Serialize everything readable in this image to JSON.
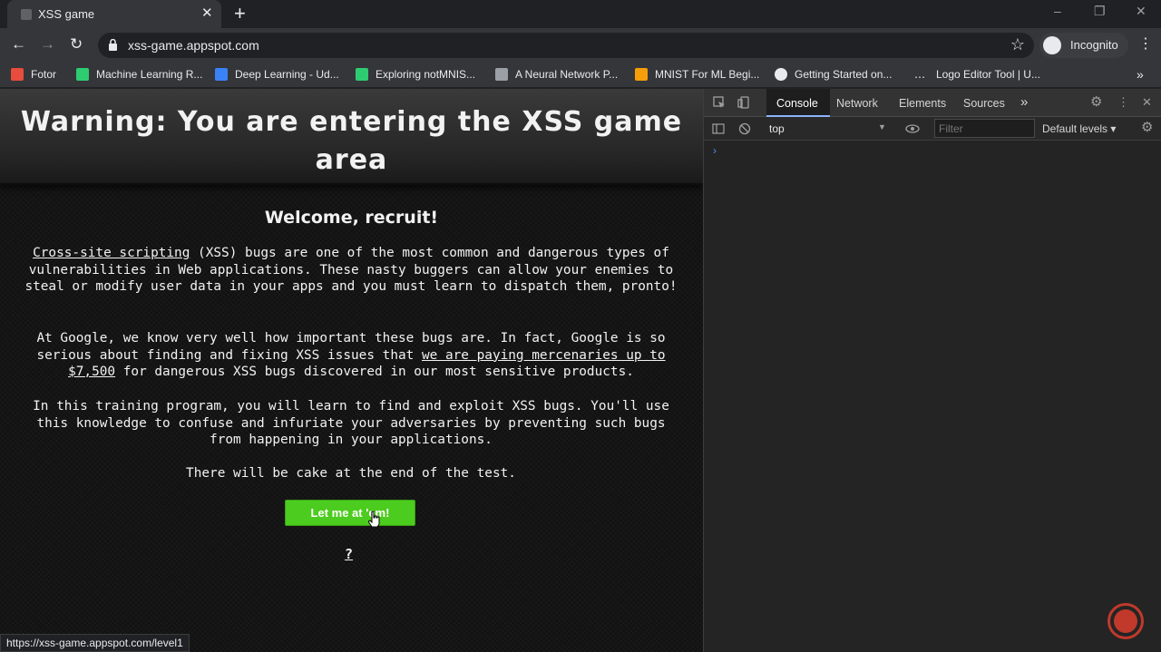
{
  "browser": {
    "tab_title": "XSS game",
    "tab_close": "✕",
    "new_tab": "+",
    "url": "xss-game.appspot.com",
    "profile_label": "Incognito",
    "window_controls": {
      "minimize": "–",
      "restore": "❐",
      "close": "✕"
    }
  },
  "bookmarks": [
    {
      "label": "Fotor",
      "color": "#e74c3c"
    },
    {
      "label": "Machine Learning R...",
      "color": "#2ecc71"
    },
    {
      "label": "Deep Learning - Ud...",
      "color": "#3b82f6"
    },
    {
      "label": "Exploring notMNIS...",
      "color": "#2ecc71"
    },
    {
      "label": "A Neural Network P...",
      "color": "#9aa0a6"
    },
    {
      "label": "MNIST For ML Begi...",
      "color": "#f59e0b"
    },
    {
      "label": "Getting Started on...",
      "color": "#e8eaed"
    },
    {
      "label": "Logo Editor Tool | U...",
      "color": "#e8eaed"
    }
  ],
  "page": {
    "banner_title_line1": "Warning: You are entering the XSS game",
    "banner_title_line2": "area",
    "welcome": "Welcome, recruit!",
    "p1_link": "Cross-site scripting",
    "p1_rest": " (XSS) bugs are one of the most common and dangerous types of vulnerabilities in Web applications. These nasty buggers can allow your enemies to steal or modify user data in your apps and you must learn to dispatch them, pronto!",
    "p2_start": "At Google, we know very well how important these bugs are. In fact, Google is so serious about finding and fixing XSS issues that ",
    "p2_link": "we are paying mercenaries up to $7,500",
    "p2_end": " for dangerous XSS bugs discovered in our most sensitive products.",
    "p3": "In this training program, you will learn to find and exploit XSS bugs. You'll use this knowledge to confuse and infuriate your adversaries by preventing such bugs from happening in your applications.",
    "p4": "There will be cake at the end of the test.",
    "start_button": "Let me at 'em!",
    "help_link": "?"
  },
  "status_url": "https://xss-game.appspot.com/level1",
  "devtools": {
    "tabs": [
      "Console",
      "Network",
      "Elements",
      "Sources"
    ],
    "active_tab": "Console",
    "more_tabs": "»",
    "context": "top",
    "filter_placeholder": "Filter",
    "levels": "Default levels ▾",
    "prompt": "›"
  },
  "colors": {
    "accent_button": "#4ccc1e",
    "record": "#c0392b"
  }
}
